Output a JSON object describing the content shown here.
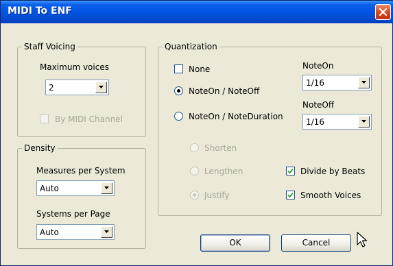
{
  "window": {
    "title": "MIDI To ENF"
  },
  "staff_voicing": {
    "group_label": "Staff Voicing",
    "max_voices_label": "Maximum voices",
    "max_voices_value": "2",
    "by_midi_channel_label": "By MIDI Channel",
    "by_midi_channel_checked": false
  },
  "density": {
    "group_label": "Density",
    "measures_label": "Measures per System",
    "measures_value": "Auto",
    "systems_label": "Systems per Page",
    "systems_value": "Auto"
  },
  "quantization": {
    "group_label": "Quantization",
    "none_label": "None",
    "none_checked": false,
    "noteon_noteoff_label": "NoteOn / NoteOff",
    "noteon_noteduration_label": "NoteOn / NoteDuration",
    "selected_mode": "NoteOn / NoteOff",
    "noteon_label": "NoteOn",
    "noteon_value": "1/16",
    "noteoff_label": "NoteOff",
    "noteoff_value": "1/16",
    "shorten_label": "Shorten",
    "lengthen_label": "Lengthen",
    "justify_label": "Justify",
    "selected_duration_mode": "Justify",
    "divide_by_beats_label": "Divide by Beats",
    "divide_by_beats_checked": true,
    "smooth_voices_label": "Smooth Voices",
    "smooth_voices_checked": true
  },
  "buttons": {
    "ok_label": "OK",
    "cancel_label": "Cancel"
  },
  "colors": {
    "titlebar": "#0055e5",
    "close": "#d6461d",
    "dialog_bg": "#ece9d8",
    "disabled_text": "#a7a69a"
  },
  "icons": {
    "close": "close-icon",
    "dropdown": "chevron-down-icon",
    "check": "check-icon",
    "cursor": "mouse-pointer-icon"
  }
}
